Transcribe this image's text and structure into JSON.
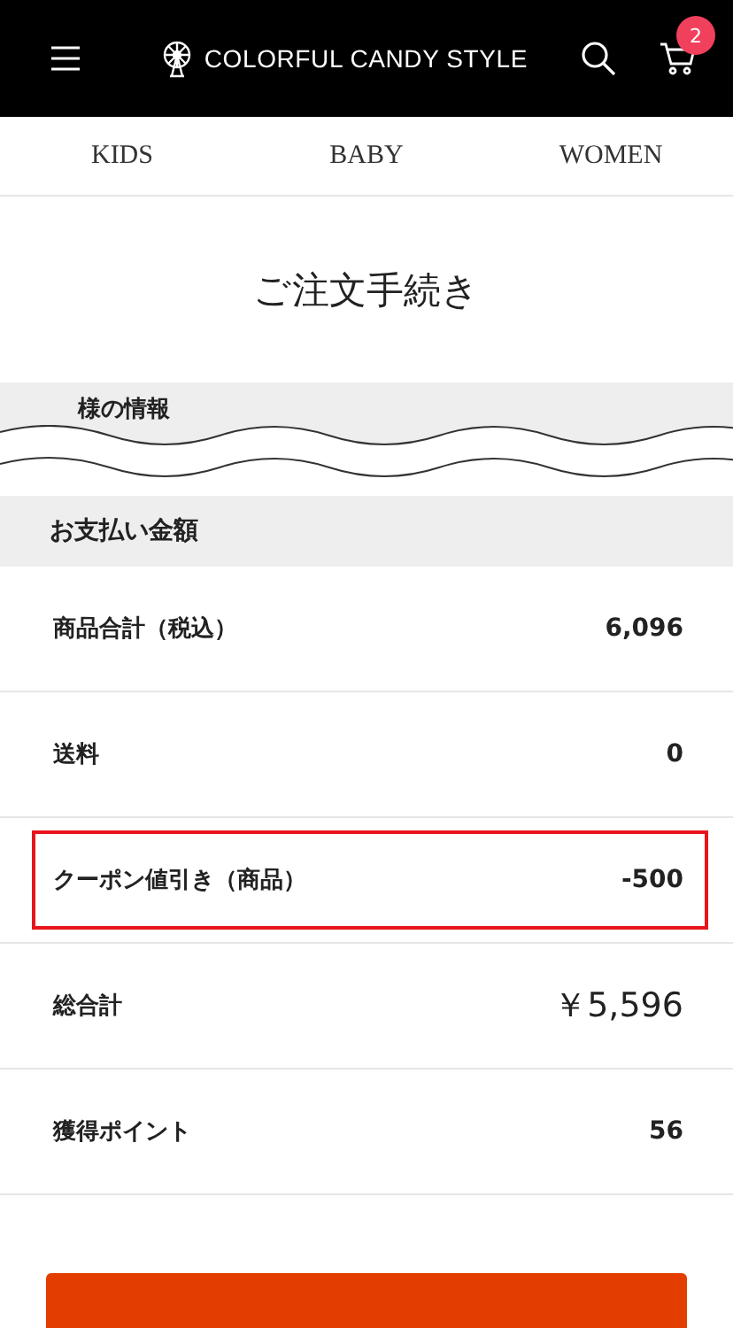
{
  "header": {
    "logo": "COLORFUL CANDY STYLE",
    "cart_count": "2"
  },
  "nav": [
    "KIDS",
    "BABY",
    "WOMEN"
  ],
  "title": "ご注文手続き",
  "cut_section": {
    "label": "様の情報"
  },
  "payment": {
    "heading": "お支払い金額",
    "rows": [
      {
        "label": "商品合計（税込）",
        "value": "6,096",
        "kind": "normal",
        "highlighted": false
      },
      {
        "label": "送料",
        "value": "0",
        "kind": "normal",
        "highlighted": false
      },
      {
        "label": "クーポン値引き（商品）",
        "value": "-500",
        "kind": "normal",
        "highlighted": true
      },
      {
        "label": "総合計",
        "value": "￥5,596",
        "kind": "total",
        "highlighted": false
      },
      {
        "label": "獲得ポイント",
        "value": "56",
        "kind": "normal",
        "highlighted": false
      }
    ]
  }
}
